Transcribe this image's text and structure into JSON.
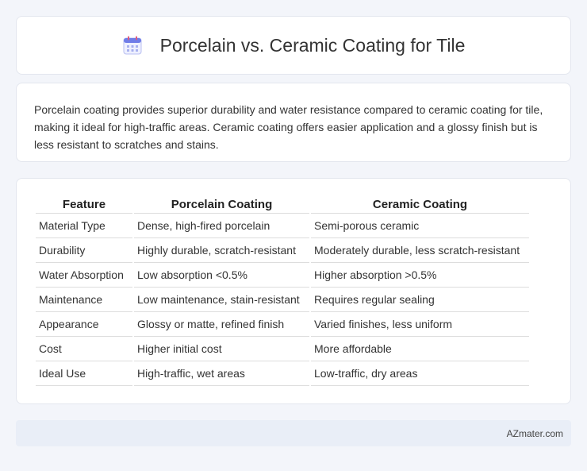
{
  "header": {
    "title": "Porcelain vs. Ceramic Coating for Tile",
    "icon": "calendar-icon"
  },
  "summary": {
    "text": "Porcelain coating provides superior durability and water resistance compared to ceramic coating for tile, making it ideal for high-traffic areas. Ceramic coating offers easier application and a glossy finish but is less resistant to scratches and stains."
  },
  "table": {
    "headers": [
      "Feature",
      "Porcelain Coating",
      "Ceramic Coating"
    ],
    "rows": [
      [
        "Material Type",
        "Dense, high-fired porcelain",
        "Semi-porous ceramic"
      ],
      [
        "Durability",
        "Highly durable, scratch-resistant",
        "Moderately durable, less scratch-resistant"
      ],
      [
        "Water Absorption",
        "Low absorption <0.5%",
        "Higher absorption >0.5%"
      ],
      [
        "Maintenance",
        "Low maintenance, stain-resistant",
        "Requires regular sealing"
      ],
      [
        "Appearance",
        "Glossy or matte, refined finish",
        "Varied finishes, less uniform"
      ],
      [
        "Cost",
        "Higher initial cost",
        "More affordable"
      ],
      [
        "Ideal Use",
        "High-traffic, wet areas",
        "Low-traffic, dry areas"
      ]
    ]
  },
  "footer": {
    "source": "AZmater.com"
  }
}
